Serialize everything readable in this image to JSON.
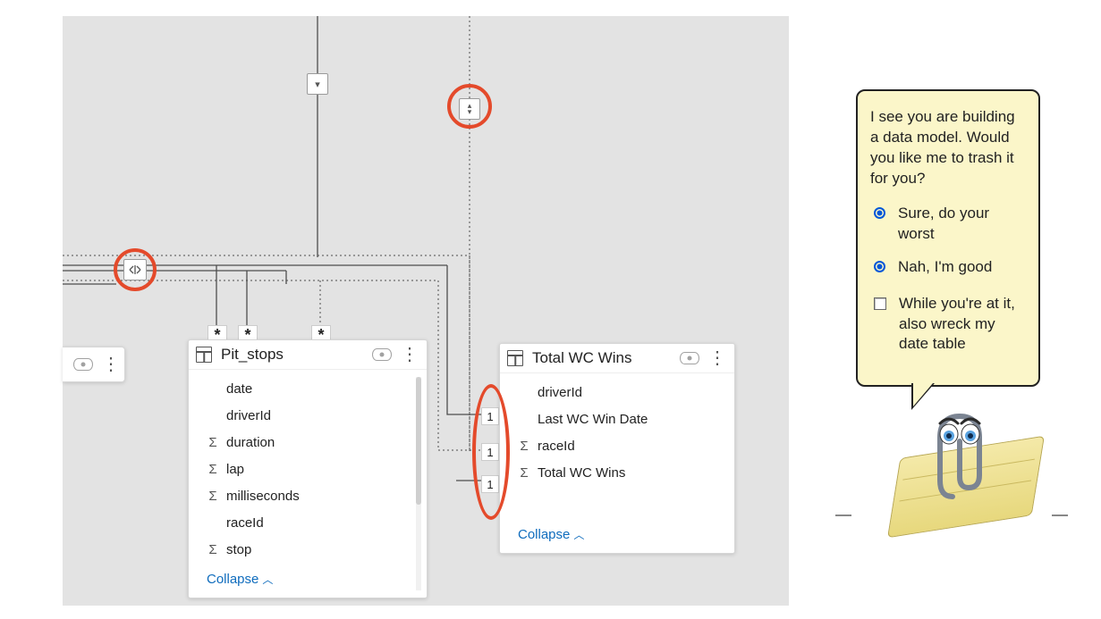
{
  "tables": {
    "pit_stops": {
      "title": "Pit_stops",
      "fields": [
        {
          "icon": "",
          "name": "date"
        },
        {
          "icon": "",
          "name": "driverId"
        },
        {
          "icon": "Σ",
          "name": "duration"
        },
        {
          "icon": "Σ",
          "name": "lap"
        },
        {
          "icon": "Σ",
          "name": "milliseconds"
        },
        {
          "icon": "",
          "name": "raceId"
        },
        {
          "icon": "Σ",
          "name": "stop"
        }
      ],
      "collapse": "Collapse"
    },
    "total_wc_wins": {
      "title": "Total WC Wins",
      "fields": [
        {
          "icon": "",
          "name": "driverId"
        },
        {
          "icon": "",
          "name": "Last WC Win Date"
        },
        {
          "icon": "Σ",
          "name": "raceId"
        },
        {
          "icon": "Σ",
          "name": "Total WC Wins"
        }
      ],
      "collapse": "Collapse"
    }
  },
  "cardinality": {
    "many": "*",
    "one": "1"
  },
  "clippy": {
    "message": "I see you are building a data model.  Would you like me to trash it for you?",
    "option1": "Sure, do your worst",
    "option2": "Nah, I'm good",
    "checkbox": "While you're at it, also wreck my date table"
  }
}
